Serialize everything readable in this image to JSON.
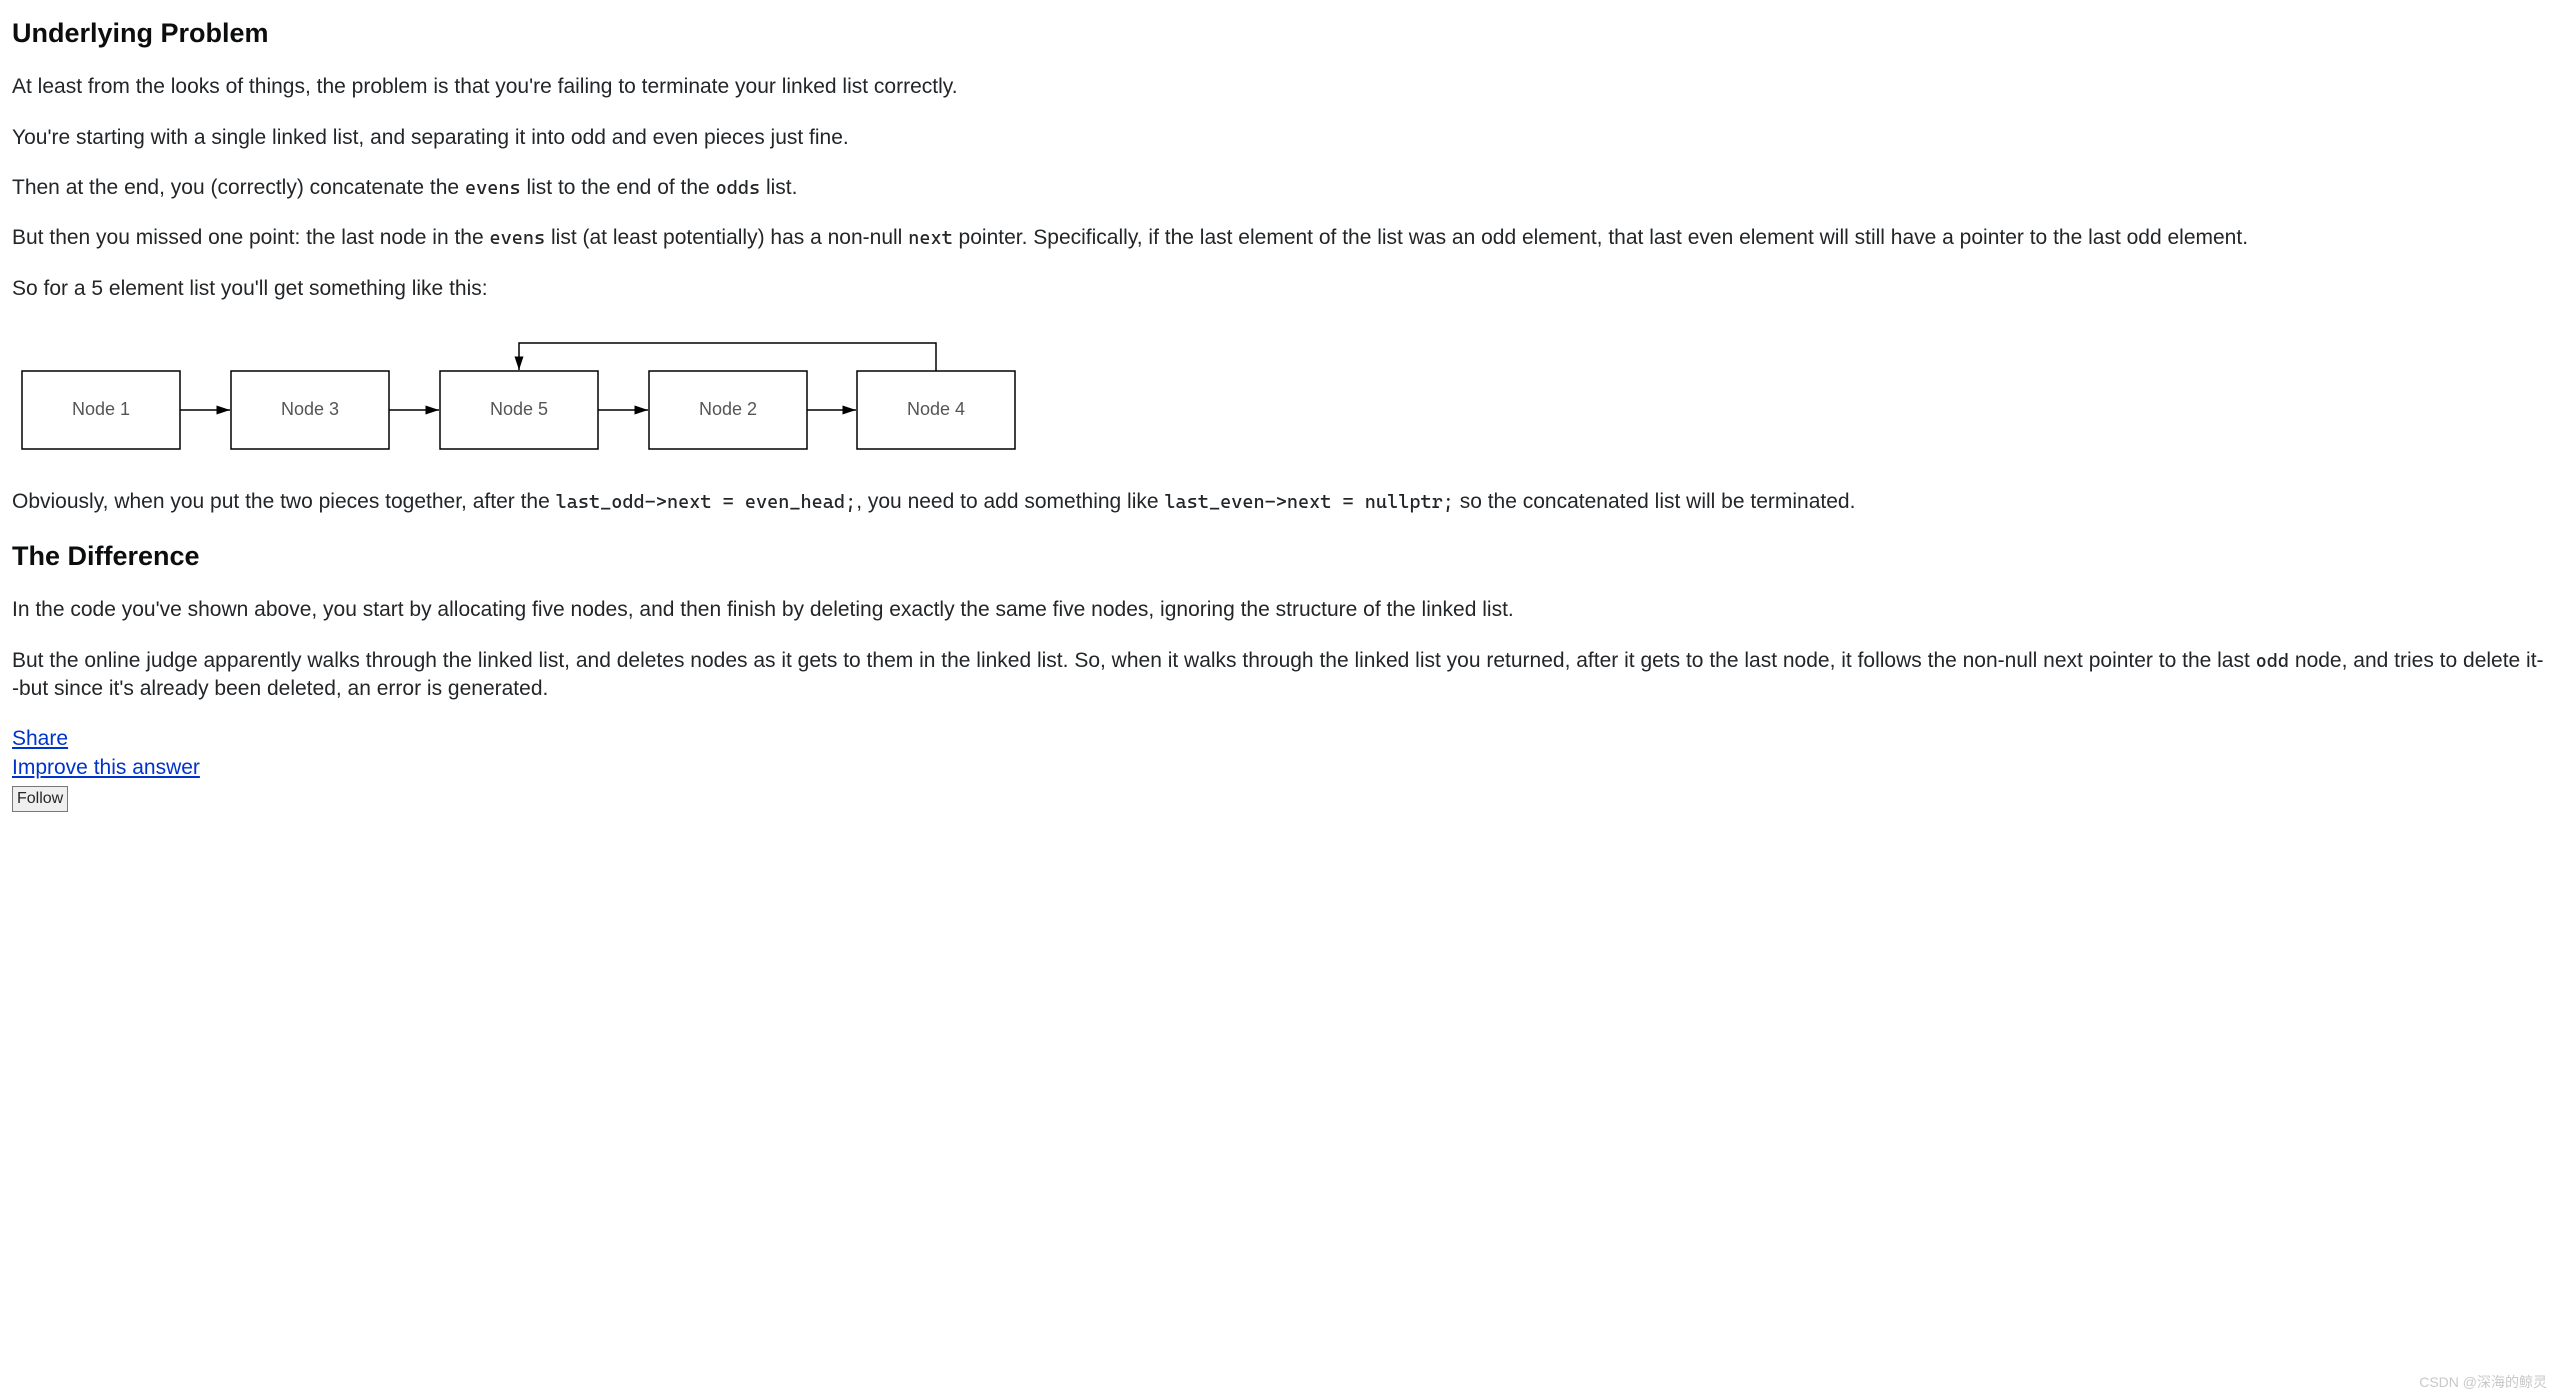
{
  "section1": {
    "title": "Underlying Problem",
    "p1": "At least from the looks of things, the problem is that you're failing to terminate your linked list correctly.",
    "p2": "You're starting with a single linked list, and separating it into odd and even pieces just fine.",
    "p3a": "Then at the end, you (correctly) concatenate the ",
    "p3_code1": "evens",
    "p3b": " list to the end of the ",
    "p3_code2": "odds",
    "p3c": " list.",
    "p4a": "But then you missed one point: the last node in the ",
    "p4_code1": "evens",
    "p4b": " list (at least potentially) has a non-null ",
    "p4_code2": "next",
    "p4c": " pointer. Specifically, if the last element of the list was an odd element, that last even element will still have a pointer to the last odd element.",
    "p5": "So for a 5 element list you'll get something like this:",
    "p6a": "Obviously, when you put the two pieces together, after the ",
    "p6_code1": "last_odd->next = even_head;",
    "p6b": ", you need to add something like ",
    "p6_code2": "last_even->next = nullptr;",
    "p6c": " so the concatenated list will be terminated."
  },
  "diagram": {
    "nodes": [
      "Node 1",
      "Node 3",
      "Node 5",
      "Node 2",
      "Node 4"
    ]
  },
  "section2": {
    "title": "The Difference",
    "p1": "In the code you've shown above, you start by allocating five nodes, and then finish by deleting exactly the same five nodes, ignoring the structure of the linked list.",
    "p2a": "But the online judge apparently walks through the linked list, and deletes nodes as it gets to them in the linked list. So, when it walks through the linked list you returned, after it gets to the last node, it follows the non-null next pointer to the last ",
    "p2_code1": "odd",
    "p2b": " node, and tries to delete it--but since it's already been deleted, an error is generated."
  },
  "actions": {
    "share": "Share",
    "improve": "Improve this answer",
    "follow": "Follow"
  },
  "watermark": "CSDN @深海的鲸灵"
}
